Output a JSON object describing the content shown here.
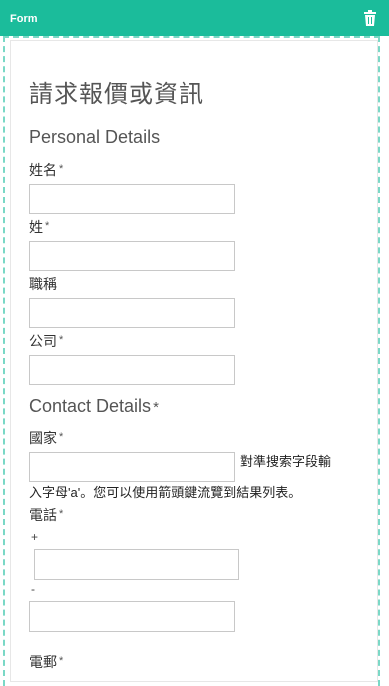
{
  "header": {
    "title": "Form",
    "trash_icon": "trash-icon"
  },
  "form": {
    "title": "請求報價或資訊",
    "personal_section": "Personal Details",
    "contact_section": "Contact Details",
    "required_marker": "*",
    "fields": {
      "first_name": {
        "label": "姓名",
        "value": ""
      },
      "last_name": {
        "label": "姓",
        "value": ""
      },
      "job_title": {
        "label": "職稱",
        "value": ""
      },
      "company": {
        "label": "公司",
        "value": ""
      },
      "country": {
        "label": "國家",
        "value": ""
      },
      "phone": {
        "label": "電話",
        "value": ""
      },
      "email": {
        "label": "電郵"
      }
    },
    "country_hint_line1": "對準搜索字段輸",
    "country_hint_line2": "入字母'a'。您可以使用箭頭鍵流覽到結果列表。",
    "phone_plus": "+",
    "phone_dash": "-"
  },
  "colors": {
    "header_bg": "#1bbc9b",
    "frame_dash": "#7ad8c6"
  }
}
